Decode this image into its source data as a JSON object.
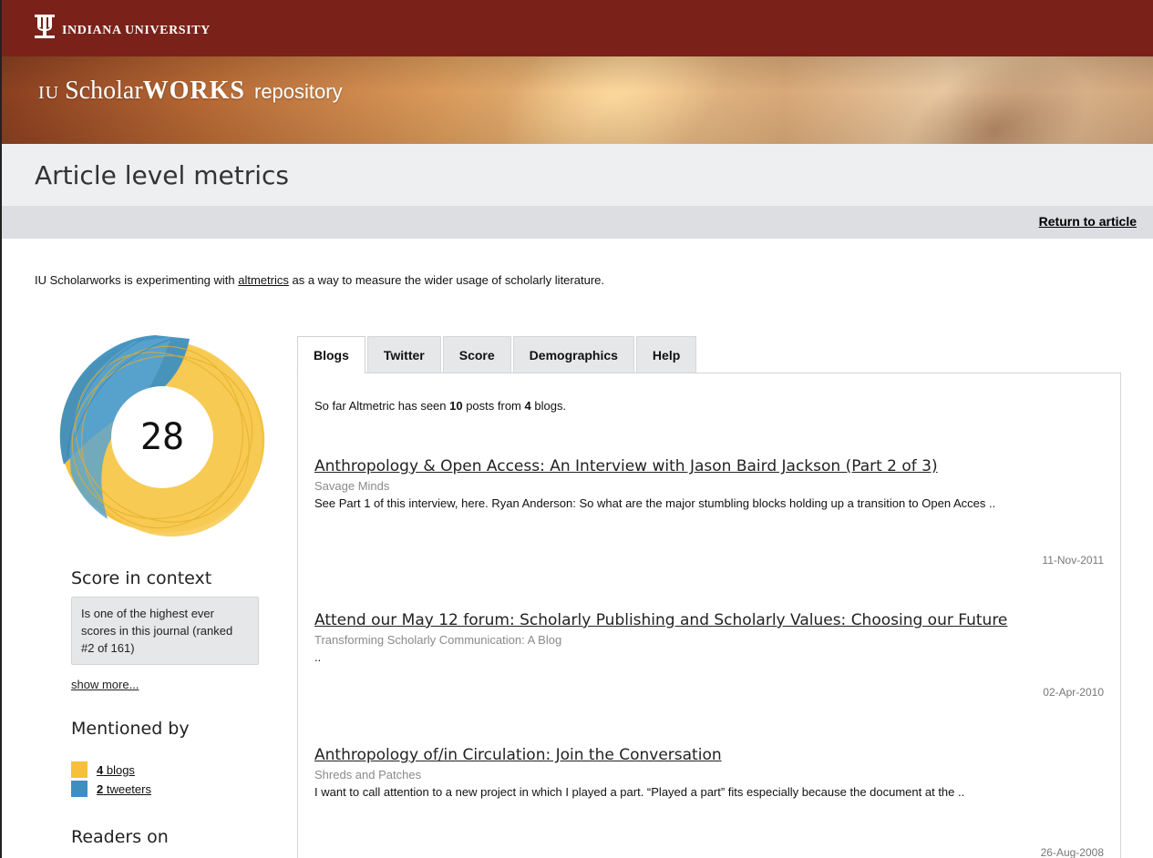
{
  "header": {
    "university": "INDIANA UNIVERSITY",
    "banner_iu": "IU",
    "banner_scholar": "Scholar",
    "banner_works": "WORKS",
    "banner_repository": "repository"
  },
  "page": {
    "title": "Article level metrics",
    "return_link": "Return to article",
    "intro_before": "IU Scholarworks is experimenting with ",
    "intro_link": "altmetrics",
    "intro_after": " as a way to measure the wider usage of scholarly literature."
  },
  "score": {
    "value": "28",
    "context_heading": "Score in context",
    "context_text": "Is one of the highest ever scores in this journal (ranked #2 of 161)",
    "show_more": "show more...",
    "mentioned_heading": "Mentioned by",
    "mentions": [
      {
        "count": "4",
        "label": " blogs",
        "color": "#f6c03b"
      },
      {
        "count": "2",
        "label": " tweeters",
        "color": "#3e8fbf"
      }
    ],
    "readers_heading": "Readers on"
  },
  "tabs": [
    {
      "label": "Blogs",
      "active": true
    },
    {
      "label": "Twitter",
      "active": false
    },
    {
      "label": "Score",
      "active": false
    },
    {
      "label": "Demographics",
      "active": false
    },
    {
      "label": "Help",
      "active": false
    }
  ],
  "blogs": {
    "summary_pre": "So far Altmetric has seen ",
    "posts_count": "10",
    "summary_mid": " posts from ",
    "blogs_count": "4",
    "summary_post": " blogs.",
    "posts": [
      {
        "title": "Anthropology & Open Access: An Interview with Jason Baird Jackson (Part 2 of 3)",
        "blog": "Savage Minds",
        "excerpt": "See Part 1 of this interview, here. Ryan Anderson: So what are the major stumbling blocks holding up a transition to Open Acces ..",
        "date": "11-Nov-2011"
      },
      {
        "title": "Attend our May 12 forum: Scholarly Publishing and Scholarly Values: Choosing our Future",
        "blog": "Transforming Scholarly Communication: A Blog",
        "excerpt": "..",
        "date": "02-Apr-2010"
      },
      {
        "title": "Anthropology of/in Circulation: Join the Conversation",
        "blog": "Shreds and Patches",
        "excerpt": "I want to call attention to a new project in which I played a part. “Played a part” fits especially because the document at the ..",
        "date": "26-Aug-2008"
      }
    ]
  },
  "colors": {
    "iu_crimson": "#7a2219",
    "altmetric_yellow": "#f6c03b",
    "altmetric_blue": "#3e8fbf"
  }
}
